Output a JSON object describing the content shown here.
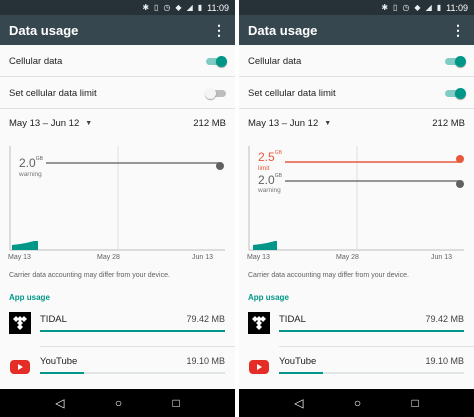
{
  "status_bar": {
    "time": "11:09"
  },
  "colors": {
    "accent": "#009688",
    "limit": "#e8593c",
    "warning": "#757575",
    "toolbar": "#37474f"
  },
  "left": {
    "title": "Data usage",
    "cellular_data_label": "Cellular data",
    "cellular_data_on": true,
    "set_limit_label": "Set cellular data limit",
    "set_limit_on": false,
    "cycle": "May 13 – Jun 12",
    "total": "212 MB",
    "chart": {
      "warning_value": "2.0",
      "warning_unit": "GB",
      "warning_label": "warning",
      "x_labels": [
        "May 13",
        "May 28",
        "Jun 13"
      ]
    },
    "note": "Carrier data accounting may differ from your device.",
    "section": "App usage",
    "apps": [
      {
        "name": "TIDAL",
        "size": "79.42 MB",
        "icon": "tidal-icon",
        "fraction": 1.0
      },
      {
        "name": "YouTube",
        "size": "19.10 MB",
        "icon": "youtube-icon",
        "fraction": 0.24
      }
    ]
  },
  "right": {
    "title": "Data usage",
    "cellular_data_label": "Cellular data",
    "cellular_data_on": true,
    "set_limit_label": "Set cellular data limit",
    "set_limit_on": true,
    "cycle": "May 13 – Jun 12",
    "total": "212 MB",
    "chart": {
      "limit_value": "2.5",
      "limit_unit": "GB",
      "limit_label": "limit",
      "warning_value": "2.0",
      "warning_unit": "GB",
      "warning_label": "warning",
      "x_labels": [
        "May 13",
        "May 28",
        "Jun 13"
      ]
    },
    "note": "Carrier data accounting may differ from your device.",
    "section": "App usage",
    "apps": [
      {
        "name": "TIDAL",
        "size": "79.42 MB",
        "icon": "tidal-icon",
        "fraction": 1.0
      },
      {
        "name": "YouTube",
        "size": "19.10 MB",
        "icon": "youtube-icon",
        "fraction": 0.24
      }
    ]
  }
}
